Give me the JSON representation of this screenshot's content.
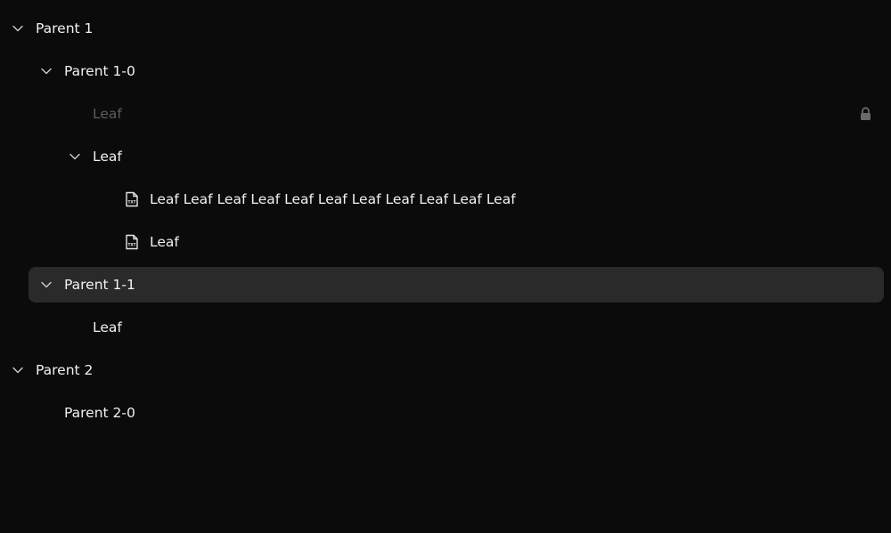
{
  "tree": {
    "parent1": {
      "label": "Parent 1",
      "expanded": true
    },
    "parent1_0": {
      "label": "Parent 1-0",
      "expanded": true
    },
    "leaf_disabled": {
      "label": "Leaf",
      "disabled": true,
      "icon": "lock-icon"
    },
    "leaf_expanded": {
      "label": "Leaf",
      "expanded": true
    },
    "leaf_long": {
      "label": "Leaf Leaf Leaf Leaf Leaf Leaf Leaf Leaf Leaf Leaf Leaf",
      "icon": "txt-file-icon"
    },
    "leaf_short": {
      "label": "Leaf",
      "icon": "txt-file-icon"
    },
    "parent1_1": {
      "label": "Parent 1-1",
      "expanded": true,
      "selected": true
    },
    "leaf_under_1_1": {
      "label": "Leaf"
    },
    "parent2": {
      "label": "Parent 2",
      "expanded": true
    },
    "parent2_0": {
      "label": "Parent 2-0"
    }
  },
  "colors": {
    "background": "#0b0b0c",
    "text": "#f2f2f2",
    "disabled_text": "#5d5d5f",
    "selected_row": "#2a2a2b"
  }
}
